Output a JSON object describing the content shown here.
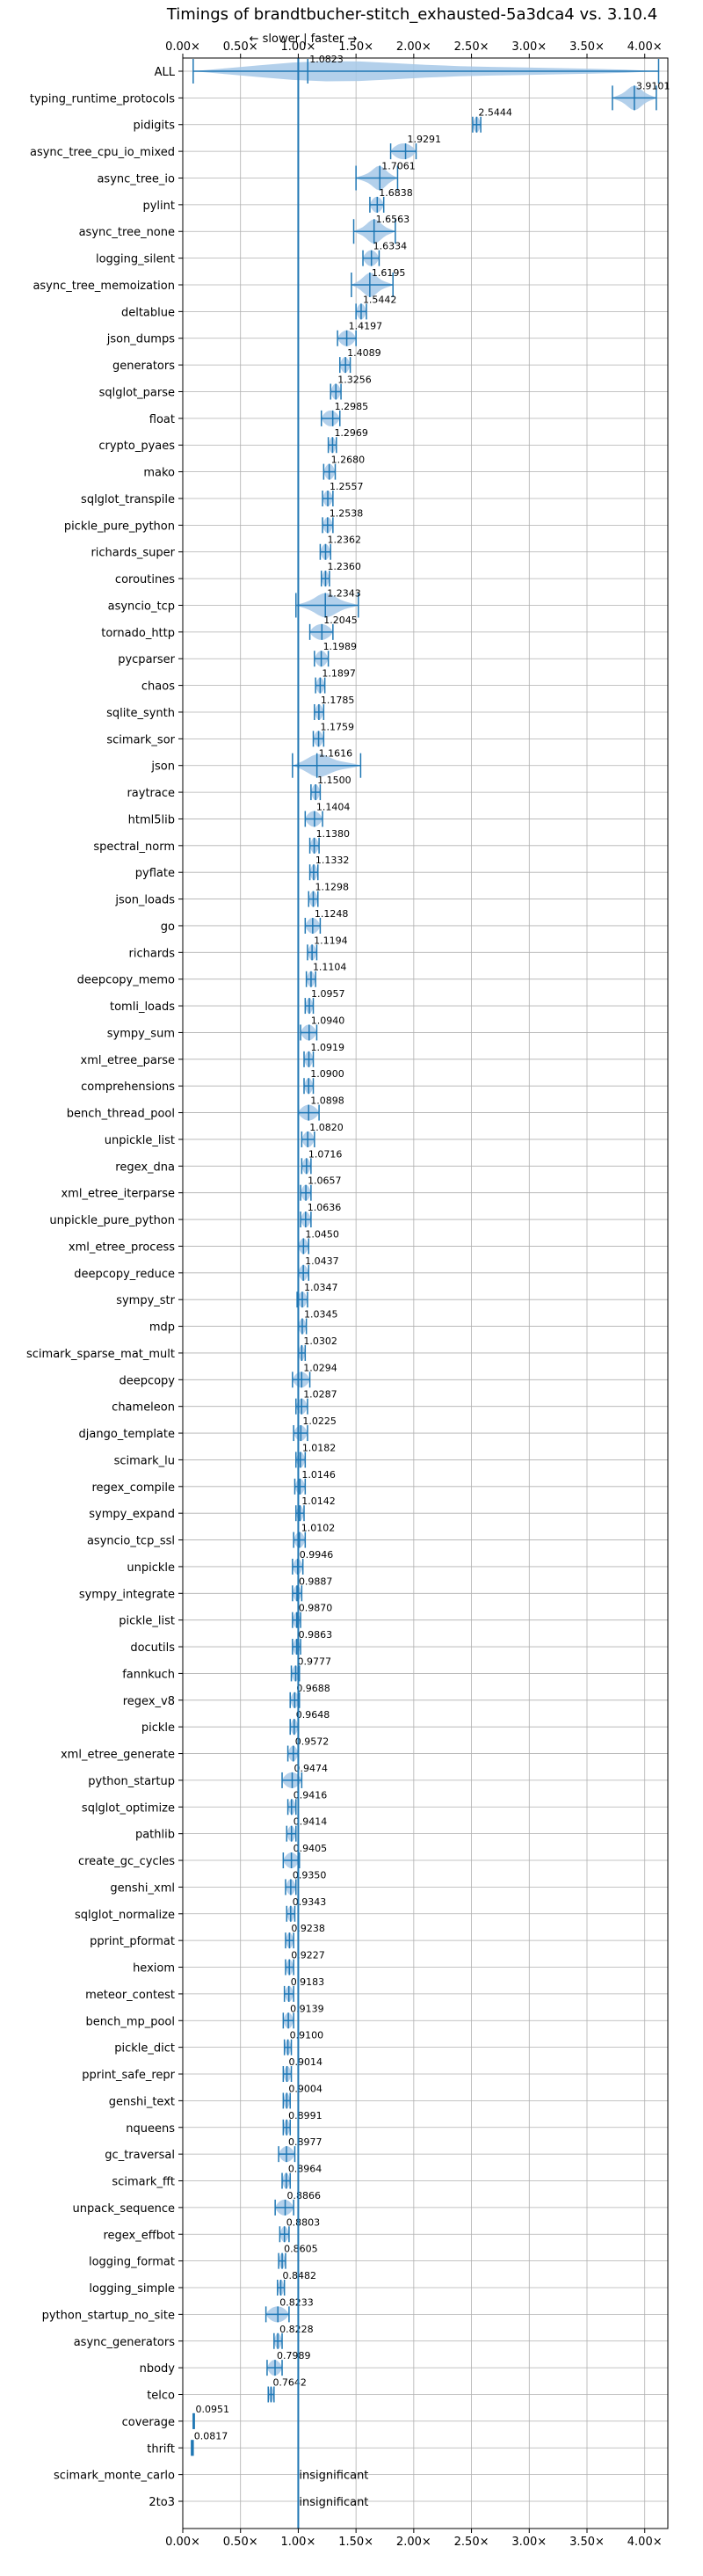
{
  "chart_data": {
    "type": "violin",
    "title": "Timings of brandtbucher-stitch_exhausted-5a3dca4 vs. 3.10.4",
    "direction_label": "← slower | faster →",
    "xlim": [
      0.0,
      4.2
    ],
    "x_ticks": [
      0.0,
      0.5,
      1.0,
      1.5,
      2.0,
      2.5,
      3.0,
      3.5,
      4.0
    ],
    "x_tick_labels": [
      "0.00×",
      "0.50×",
      "1.00×",
      "1.50×",
      "2.00×",
      "2.50×",
      "3.00×",
      "3.50×",
      "4.00×"
    ],
    "reference_line": 1.0,
    "grid": true,
    "accent_color": "#1f77b4",
    "violin_color": "#a6c8e8",
    "significance_label": "insignificant",
    "categories": [
      {
        "name": "ALL",
        "value": 1.0823,
        "label": "1.0823",
        "lo": 0.09,
        "hi": 4.12
      },
      {
        "name": "typing_runtime_protocols",
        "value": 3.9101,
        "label": "3.9101",
        "lo": 3.72,
        "hi": 4.1
      },
      {
        "name": "pidigits",
        "value": 2.5444,
        "label": "2.5444",
        "lo": 2.51,
        "hi": 2.58
      },
      {
        "name": "async_tree_cpu_io_mixed",
        "value": 1.9291,
        "label": "1.9291",
        "lo": 1.8,
        "hi": 2.02
      },
      {
        "name": "async_tree_io",
        "value": 1.7061,
        "label": "1.7061",
        "lo": 1.5,
        "hi": 1.86
      },
      {
        "name": "pylint",
        "value": 1.6838,
        "label": "1.6838",
        "lo": 1.62,
        "hi": 1.74
      },
      {
        "name": "async_tree_none",
        "value": 1.6563,
        "label": "1.6563",
        "lo": 1.48,
        "hi": 1.84
      },
      {
        "name": "logging_silent",
        "value": 1.6334,
        "label": "1.6334",
        "lo": 1.56,
        "hi": 1.7
      },
      {
        "name": "async_tree_memoization",
        "value": 1.6195,
        "label": "1.6195",
        "lo": 1.46,
        "hi": 1.82
      },
      {
        "name": "deltablue",
        "value": 1.5442,
        "label": "1.5442",
        "lo": 1.5,
        "hi": 1.59
      },
      {
        "name": "json_dumps",
        "value": 1.4197,
        "label": "1.4197",
        "lo": 1.34,
        "hi": 1.5
      },
      {
        "name": "generators",
        "value": 1.4089,
        "label": "1.4089",
        "lo": 1.36,
        "hi": 1.45
      },
      {
        "name": "sqlglot_parse",
        "value": 1.3256,
        "label": "1.3256",
        "lo": 1.28,
        "hi": 1.37
      },
      {
        "name": "float",
        "value": 1.2985,
        "label": "1.2985",
        "lo": 1.2,
        "hi": 1.36
      },
      {
        "name": "crypto_pyaes",
        "value": 1.2969,
        "label": "1.2969",
        "lo": 1.26,
        "hi": 1.33
      },
      {
        "name": "mako",
        "value": 1.268,
        "label": "1.2680",
        "lo": 1.22,
        "hi": 1.32
      },
      {
        "name": "sqlglot_transpile",
        "value": 1.2557,
        "label": "1.2557",
        "lo": 1.21,
        "hi": 1.3
      },
      {
        "name": "pickle_pure_python",
        "value": 1.2538,
        "label": "1.2538",
        "lo": 1.21,
        "hi": 1.3
      },
      {
        "name": "richards_super",
        "value": 1.2362,
        "label": "1.2362",
        "lo": 1.19,
        "hi": 1.28
      },
      {
        "name": "coroutines",
        "value": 1.236,
        "label": "1.2360",
        "lo": 1.2,
        "hi": 1.27
      },
      {
        "name": "asyncio_tcp",
        "value": 1.2343,
        "label": "1.2343",
        "lo": 0.98,
        "hi": 1.52
      },
      {
        "name": "tornado_http",
        "value": 1.2045,
        "label": "1.2045",
        "lo": 1.1,
        "hi": 1.3
      },
      {
        "name": "pycparser",
        "value": 1.1989,
        "label": "1.1989",
        "lo": 1.14,
        "hi": 1.26
      },
      {
        "name": "chaos",
        "value": 1.1897,
        "label": "1.1897",
        "lo": 1.15,
        "hi": 1.23
      },
      {
        "name": "sqlite_synth",
        "value": 1.1785,
        "label": "1.1785",
        "lo": 1.14,
        "hi": 1.22
      },
      {
        "name": "scimark_sor",
        "value": 1.1759,
        "label": "1.1759",
        "lo": 1.13,
        "hi": 1.22
      },
      {
        "name": "json",
        "value": 1.1616,
        "label": "1.1616",
        "lo": 0.95,
        "hi": 1.54
      },
      {
        "name": "raytrace",
        "value": 1.15,
        "label": "1.1500",
        "lo": 1.11,
        "hi": 1.19
      },
      {
        "name": "html5lib",
        "value": 1.1404,
        "label": "1.1404",
        "lo": 1.06,
        "hi": 1.21
      },
      {
        "name": "spectral_norm",
        "value": 1.138,
        "label": "1.1380",
        "lo": 1.1,
        "hi": 1.18
      },
      {
        "name": "pyflate",
        "value": 1.1332,
        "label": "1.1332",
        "lo": 1.1,
        "hi": 1.17
      },
      {
        "name": "json_loads",
        "value": 1.1298,
        "label": "1.1298",
        "lo": 1.09,
        "hi": 1.17
      },
      {
        "name": "go",
        "value": 1.1248,
        "label": "1.1248",
        "lo": 1.06,
        "hi": 1.19
      },
      {
        "name": "richards",
        "value": 1.1194,
        "label": "1.1194",
        "lo": 1.08,
        "hi": 1.16
      },
      {
        "name": "deepcopy_memo",
        "value": 1.1104,
        "label": "1.1104",
        "lo": 1.07,
        "hi": 1.15
      },
      {
        "name": "tomli_loads",
        "value": 1.0957,
        "label": "1.0957",
        "lo": 1.06,
        "hi": 1.13
      },
      {
        "name": "sympy_sum",
        "value": 1.094,
        "label": "1.0940",
        "lo": 1.02,
        "hi": 1.16
      },
      {
        "name": "xml_etree_parse",
        "value": 1.0919,
        "label": "1.0919",
        "lo": 1.05,
        "hi": 1.13
      },
      {
        "name": "comprehensions",
        "value": 1.09,
        "label": "1.0900",
        "lo": 1.05,
        "hi": 1.13
      },
      {
        "name": "bench_thread_pool",
        "value": 1.0898,
        "label": "1.0898",
        "lo": 1.0,
        "hi": 1.18
      },
      {
        "name": "unpickle_list",
        "value": 1.082,
        "label": "1.0820",
        "lo": 1.03,
        "hi": 1.14
      },
      {
        "name": "regex_dna",
        "value": 1.0716,
        "label": "1.0716",
        "lo": 1.03,
        "hi": 1.11
      },
      {
        "name": "xml_etree_iterparse",
        "value": 1.0657,
        "label": "1.0657",
        "lo": 1.02,
        "hi": 1.11
      },
      {
        "name": "unpickle_pure_python",
        "value": 1.0636,
        "label": "1.0636",
        "lo": 1.02,
        "hi": 1.11
      },
      {
        "name": "xml_etree_process",
        "value": 1.045,
        "label": "1.0450",
        "lo": 1.0,
        "hi": 1.09
      },
      {
        "name": "deepcopy_reduce",
        "value": 1.0437,
        "label": "1.0437",
        "lo": 1.0,
        "hi": 1.09
      },
      {
        "name": "sympy_str",
        "value": 1.0347,
        "label": "1.0347",
        "lo": 0.99,
        "hi": 1.08
      },
      {
        "name": "mdp",
        "value": 1.0345,
        "label": "1.0345",
        "lo": 1.0,
        "hi": 1.07
      },
      {
        "name": "scimark_sparse_mat_mult",
        "value": 1.0302,
        "label": "1.0302",
        "lo": 1.0,
        "hi": 1.06
      },
      {
        "name": "deepcopy",
        "value": 1.0294,
        "label": "1.0294",
        "lo": 0.95,
        "hi": 1.1
      },
      {
        "name": "chameleon",
        "value": 1.0287,
        "label": "1.0287",
        "lo": 0.98,
        "hi": 1.08
      },
      {
        "name": "django_template",
        "value": 1.0225,
        "label": "1.0225",
        "lo": 0.96,
        "hi": 1.08
      },
      {
        "name": "scimark_lu",
        "value": 1.0182,
        "label": "1.0182",
        "lo": 0.98,
        "hi": 1.06
      },
      {
        "name": "regex_compile",
        "value": 1.0146,
        "label": "1.0146",
        "lo": 0.97,
        "hi": 1.06
      },
      {
        "name": "sympy_expand",
        "value": 1.0142,
        "label": "1.0142",
        "lo": 0.98,
        "hi": 1.05
      },
      {
        "name": "asyncio_tcp_ssl",
        "value": 1.0102,
        "label": "1.0102",
        "lo": 0.96,
        "hi": 1.06
      },
      {
        "name": "unpickle",
        "value": 0.9946,
        "label": "0.9946",
        "lo": 0.95,
        "hi": 1.04
      },
      {
        "name": "sympy_integrate",
        "value": 0.9887,
        "label": "0.9887",
        "lo": 0.95,
        "hi": 1.03
      },
      {
        "name": "pickle_list",
        "value": 0.987,
        "label": "0.9870",
        "lo": 0.95,
        "hi": 1.02
      },
      {
        "name": "docutils",
        "value": 0.9863,
        "label": "0.9863",
        "lo": 0.95,
        "hi": 1.02
      },
      {
        "name": "fannkuch",
        "value": 0.9777,
        "label": "0.9777",
        "lo": 0.94,
        "hi": 1.01
      },
      {
        "name": "regex_v8",
        "value": 0.9688,
        "label": "0.9688",
        "lo": 0.93,
        "hi": 1.01
      },
      {
        "name": "pickle",
        "value": 0.9648,
        "label": "0.9648",
        "lo": 0.93,
        "hi": 1.0
      },
      {
        "name": "xml_etree_generate",
        "value": 0.9572,
        "label": "0.9572",
        "lo": 0.91,
        "hi": 1.0
      },
      {
        "name": "python_startup",
        "value": 0.9474,
        "label": "0.9474",
        "lo": 0.86,
        "hi": 1.03
      },
      {
        "name": "sqlglot_optimize",
        "value": 0.9416,
        "label": "0.9416",
        "lo": 0.91,
        "hi": 0.98
      },
      {
        "name": "pathlib",
        "value": 0.9414,
        "label": "0.9414",
        "lo": 0.9,
        "hi": 0.98
      },
      {
        "name": "create_gc_cycles",
        "value": 0.9405,
        "label": "0.9405",
        "lo": 0.87,
        "hi": 1.01
      },
      {
        "name": "genshi_xml",
        "value": 0.935,
        "label": "0.9350",
        "lo": 0.89,
        "hi": 0.98
      },
      {
        "name": "sqlglot_normalize",
        "value": 0.9343,
        "label": "0.9343",
        "lo": 0.9,
        "hi": 0.97
      },
      {
        "name": "pprint_pformat",
        "value": 0.9238,
        "label": "0.9238",
        "lo": 0.89,
        "hi": 0.96
      },
      {
        "name": "hexiom",
        "value": 0.9227,
        "label": "0.9227",
        "lo": 0.89,
        "hi": 0.96
      },
      {
        "name": "meteor_contest",
        "value": 0.9183,
        "label": "0.9183",
        "lo": 0.88,
        "hi": 0.96
      },
      {
        "name": "bench_mp_pool",
        "value": 0.9139,
        "label": "0.9139",
        "lo": 0.87,
        "hi": 0.96
      },
      {
        "name": "pickle_dict",
        "value": 0.91,
        "label": "0.9100",
        "lo": 0.88,
        "hi": 0.94
      },
      {
        "name": "pprint_safe_repr",
        "value": 0.9014,
        "label": "0.9014",
        "lo": 0.87,
        "hi": 0.94
      },
      {
        "name": "genshi_text",
        "value": 0.9004,
        "label": "0.9004",
        "lo": 0.87,
        "hi": 0.93
      },
      {
        "name": "nqueens",
        "value": 0.8991,
        "label": "0.8991",
        "lo": 0.87,
        "hi": 0.93
      },
      {
        "name": "gc_traversal",
        "value": 0.8977,
        "label": "0.8977",
        "lo": 0.83,
        "hi": 0.97
      },
      {
        "name": "scimark_fft",
        "value": 0.8964,
        "label": "0.8964",
        "lo": 0.86,
        "hi": 0.93
      },
      {
        "name": "unpack_sequence",
        "value": 0.8866,
        "label": "0.8866",
        "lo": 0.8,
        "hi": 0.96
      },
      {
        "name": "regex_effbot",
        "value": 0.8803,
        "label": "0.8803",
        "lo": 0.84,
        "hi": 0.92
      },
      {
        "name": "logging_format",
        "value": 0.8605,
        "label": "0.8605",
        "lo": 0.83,
        "hi": 0.89
      },
      {
        "name": "logging_simple",
        "value": 0.8482,
        "label": "0.8482",
        "lo": 0.82,
        "hi": 0.88
      },
      {
        "name": "python_startup_no_site",
        "value": 0.8233,
        "label": "0.8233",
        "lo": 0.72,
        "hi": 0.92
      },
      {
        "name": "async_generators",
        "value": 0.8228,
        "label": "0.8228",
        "lo": 0.79,
        "hi": 0.86
      },
      {
        "name": "nbody",
        "value": 0.7989,
        "label": "0.7989",
        "lo": 0.73,
        "hi": 0.86
      },
      {
        "name": "telco",
        "value": 0.7642,
        "label": "0.7642",
        "lo": 0.74,
        "hi": 0.79
      },
      {
        "name": "coverage",
        "value": 0.0951,
        "label": "0.0951",
        "lo": 0.09,
        "hi": 0.1
      },
      {
        "name": "thrift",
        "value": 0.0817,
        "label": "0.0817",
        "lo": 0.075,
        "hi": 0.09
      },
      {
        "name": "scimark_monte_carlo",
        "value": null,
        "label": "insignificant",
        "lo": null,
        "hi": null
      },
      {
        "name": "2to3",
        "value": null,
        "label": "insignificant",
        "lo": null,
        "hi": null
      }
    ]
  }
}
